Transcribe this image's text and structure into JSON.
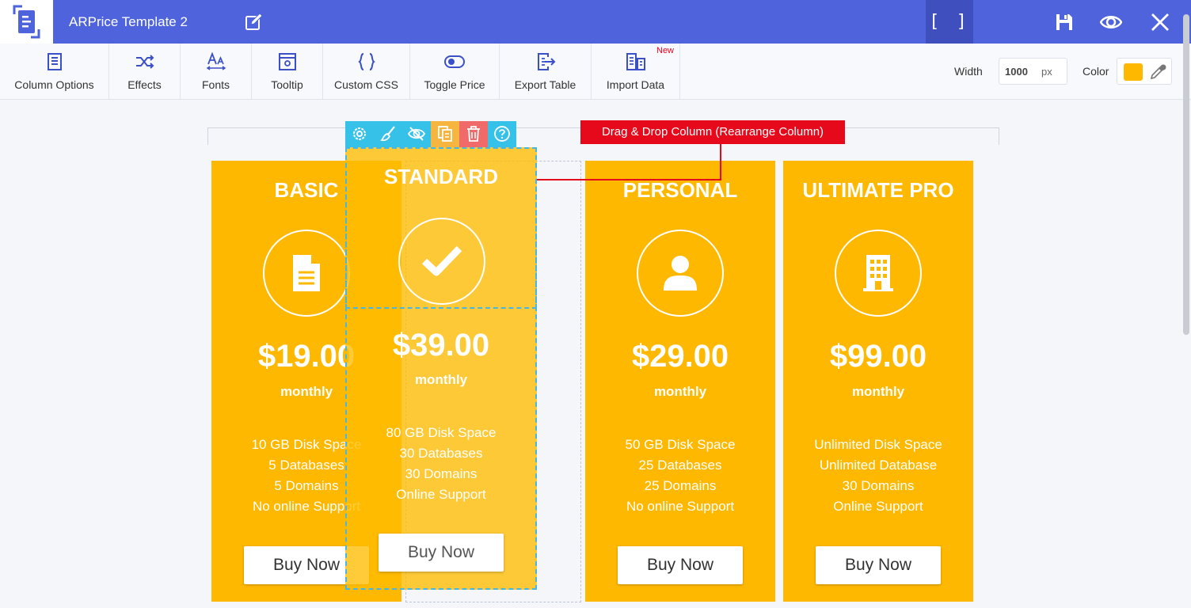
{
  "header": {
    "title": "ARPrice Template 2",
    "fullscreen_label": "[ ]"
  },
  "toolbar": {
    "items": [
      {
        "label": "Column Options",
        "icon": "column-options-icon"
      },
      {
        "label": "Effects",
        "icon": "shuffle-icon"
      },
      {
        "label": "Fonts",
        "icon": "fonts-icon"
      },
      {
        "label": "Tooltip",
        "icon": "tooltip-icon"
      },
      {
        "label": "Custom CSS",
        "icon": "braces-icon"
      },
      {
        "label": "Toggle Price",
        "icon": "toggle-icon"
      },
      {
        "label": "Export Table",
        "icon": "export-icon"
      },
      {
        "label": "Import Data",
        "icon": "import-icon"
      }
    ],
    "new_badge": "New",
    "width_label": "Width",
    "width_value": "1000",
    "width_unit": "px",
    "color_label": "Color",
    "color_value": "#ffb800"
  },
  "tooltip": "Drag & Drop Column (Rearrange Column)",
  "columns": [
    {
      "title": "BASIC",
      "icon": "document-icon",
      "price": "$19.00",
      "period": "monthly",
      "features": [
        "10 GB Disk Space",
        "5 Databases",
        "5 Domains",
        "No online Support"
      ],
      "button": "Buy Now"
    },
    {
      "title": "STANDARD",
      "icon": "check-icon",
      "price": "$39.00",
      "period": "monthly",
      "features": [
        "80 GB Disk Space",
        "30 Databases",
        "30 Domains",
        "Online Support"
      ],
      "button": "Buy Now"
    },
    {
      "title": "PERSONAL",
      "icon": "user-icon",
      "price": "$29.00",
      "period": "monthly",
      "features": [
        "50 GB Disk Space",
        "25 Databases",
        "25 Domains",
        "No online Support"
      ],
      "button": "Buy Now"
    },
    {
      "title": "ULTIMATE PRO",
      "icon": "building-icon",
      "price": "$99.00",
      "period": "monthly",
      "features": [
        "Unlimited Disk Space",
        "Unlimited Database",
        "30 Domains",
        "Online Support"
      ],
      "button": "Buy Now"
    }
  ],
  "colors": {
    "topbar": "#4f63dd",
    "column": "#ffb800",
    "tooltip": "#e5091b",
    "selection": "#45b6e6",
    "duplicate": "#f5b53f",
    "delete": "#f06a6a"
  }
}
